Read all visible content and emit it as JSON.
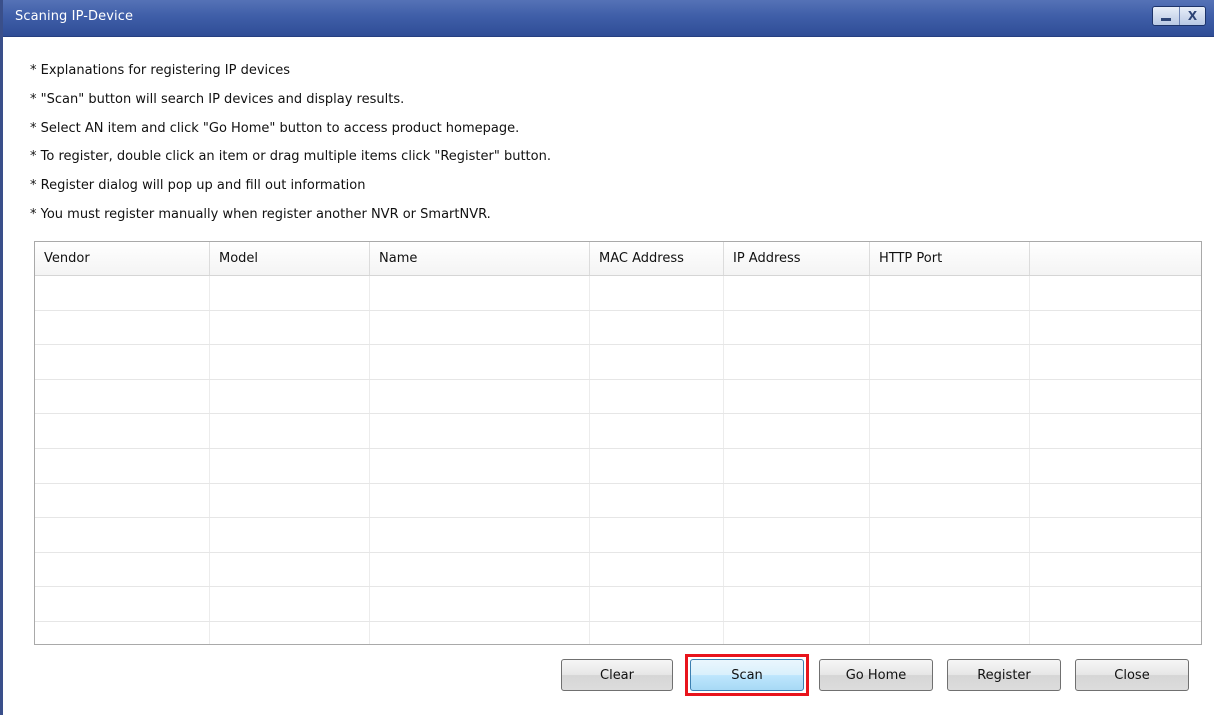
{
  "window": {
    "title": "Scaning IP-Device",
    "close_glyph": "X"
  },
  "explanations": [
    "* Explanations for registering IP devices",
    "* \"Scan\" button will search IP devices and display results.",
    "* Select AN item and click \"Go Home\" button to access product homepage.",
    "* To register, double click an item or drag multiple items click \"Register\" button.",
    "* Register dialog will pop up and fill out information",
    "* You must register manually when register another NVR or SmartNVR."
  ],
  "table": {
    "columns": [
      "Vendor",
      "Model",
      "Name",
      "MAC Address",
      "IP Address",
      "HTTP Port",
      ""
    ],
    "rows": []
  },
  "buttons": {
    "clear": "Clear",
    "scan": "Scan",
    "go_home": "Go Home",
    "register": "Register",
    "close": "Close"
  },
  "colors": {
    "titlebar": "#3f5ea8",
    "highlight": "#e8141c"
  }
}
